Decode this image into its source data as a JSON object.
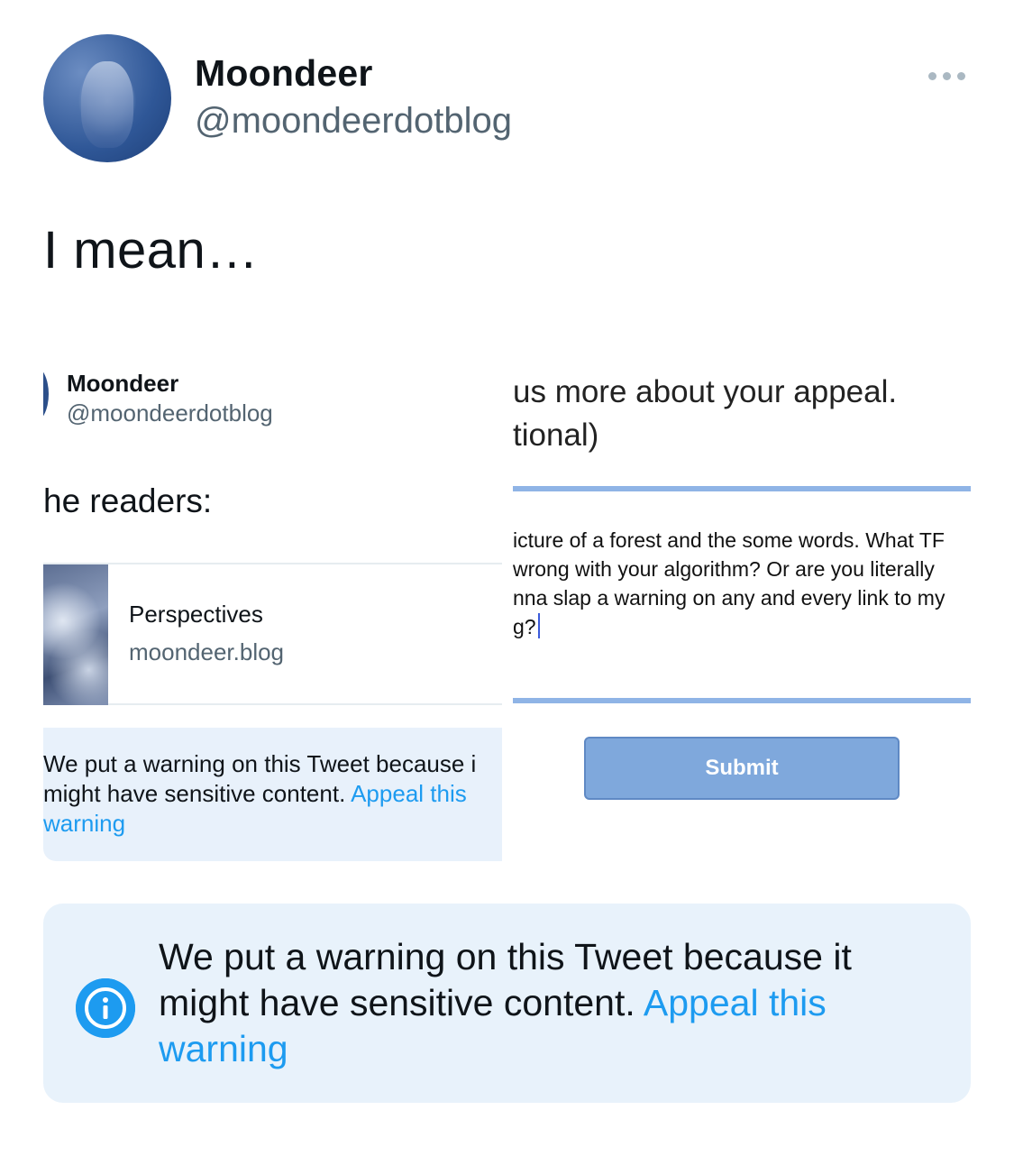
{
  "tweet": {
    "author_name": "Moondeer",
    "author_handle": "@moondeerdotblog",
    "text": "I mean…"
  },
  "attached_image": {
    "left_panel": {
      "author_name": "Moondeer",
      "author_handle": "@moondeerdotblog",
      "readers_text": "he readers:",
      "card_title": "Perspectives",
      "card_url": "moondeer.blog",
      "warning_text": "We put a warning on this Tweet because i might have sensitive content.",
      "warning_link": "Appeal this warning"
    },
    "right_panel": {
      "line1": "us more about your appeal.",
      "line2": "tional)",
      "textarea_lines": [
        "icture of a forest and the some words. What TF",
        "wrong with your algorithm? Or are you literally",
        "nna slap a warning on any and every link to my",
        "g?"
      ],
      "submit_label": "Submit"
    }
  },
  "warning": {
    "text": "We put a warning on this Tweet because it might have sensitive content.",
    "link": "Appeal this warning",
    "icon": "info-icon"
  },
  "colors": {
    "accent": "#1d9bf0",
    "warning_bg": "#e8f2fb",
    "secondary_text": "#536471",
    "submit_bg": "#7fa8dc"
  }
}
